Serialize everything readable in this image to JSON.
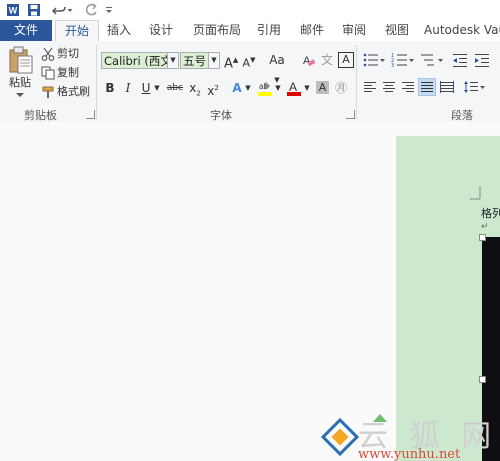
{
  "qat": {
    "icons": [
      "word-logo-icon",
      "save-icon",
      "undo-icon",
      "redo-icon",
      "customize-qat-icon"
    ]
  },
  "tabs": [
    {
      "label": "文件"
    },
    {
      "label": "开始"
    },
    {
      "label": "插入"
    },
    {
      "label": "设计"
    },
    {
      "label": "页面布局"
    },
    {
      "label": "引用"
    },
    {
      "label": "邮件"
    },
    {
      "label": "审阅"
    },
    {
      "label": "视图"
    },
    {
      "label": "Autodesk Vau"
    }
  ],
  "clipboard": {
    "paste_label": "粘贴",
    "cut_label": "剪切",
    "copy_label": "复制",
    "format_painter_label": "格式刷",
    "group_label": "剪贴板"
  },
  "font": {
    "font_name": "Calibri (西文I",
    "font_size": "五号",
    "grow": "A",
    "shrink": "A",
    "change_case": "Aa",
    "bold": "B",
    "italic": "I",
    "underline": "U",
    "strikethrough": "abc",
    "subscript": "x",
    "superscript": "x",
    "text_effect": "A",
    "font_color": "A",
    "char_shading": "A",
    "phonetic": "文",
    "enclosed": "㊊",
    "group_label": "字体"
  },
  "paragraph": {
    "group_label": "段落"
  },
  "document": {
    "caption": "格列"
  },
  "colors": {
    "file_tab": "#2b579a",
    "ribbon_bg": "#f5f6f7",
    "page_bg": "#cce8cf",
    "highlight_yellow": "#ffff00",
    "font_red": "#e00000"
  },
  "watermark": {
    "cn": "云 狐 网",
    "url": "www.yunhu.net"
  }
}
